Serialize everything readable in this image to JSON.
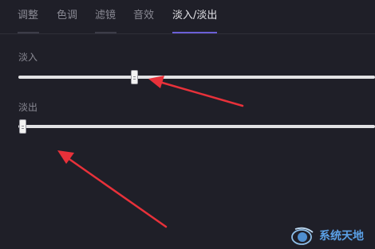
{
  "tabs": [
    {
      "label": "调整",
      "active": false
    },
    {
      "label": "色调",
      "active": false
    },
    {
      "label": "滤镜",
      "active": false
    },
    {
      "label": "音效",
      "active": false
    },
    {
      "label": "淡入/淡出",
      "active": true
    }
  ],
  "fade_in": {
    "label": "淡入",
    "value_fraction": 0.32
  },
  "fade_out": {
    "label": "淡出",
    "value_fraction": 0.0
  },
  "watermark": {
    "text": "系统天地"
  },
  "colors": {
    "background": "#1f1f28",
    "accent": "#6b5fd6",
    "arrow": "#e8313a",
    "watermark": "#5aa0e6"
  }
}
